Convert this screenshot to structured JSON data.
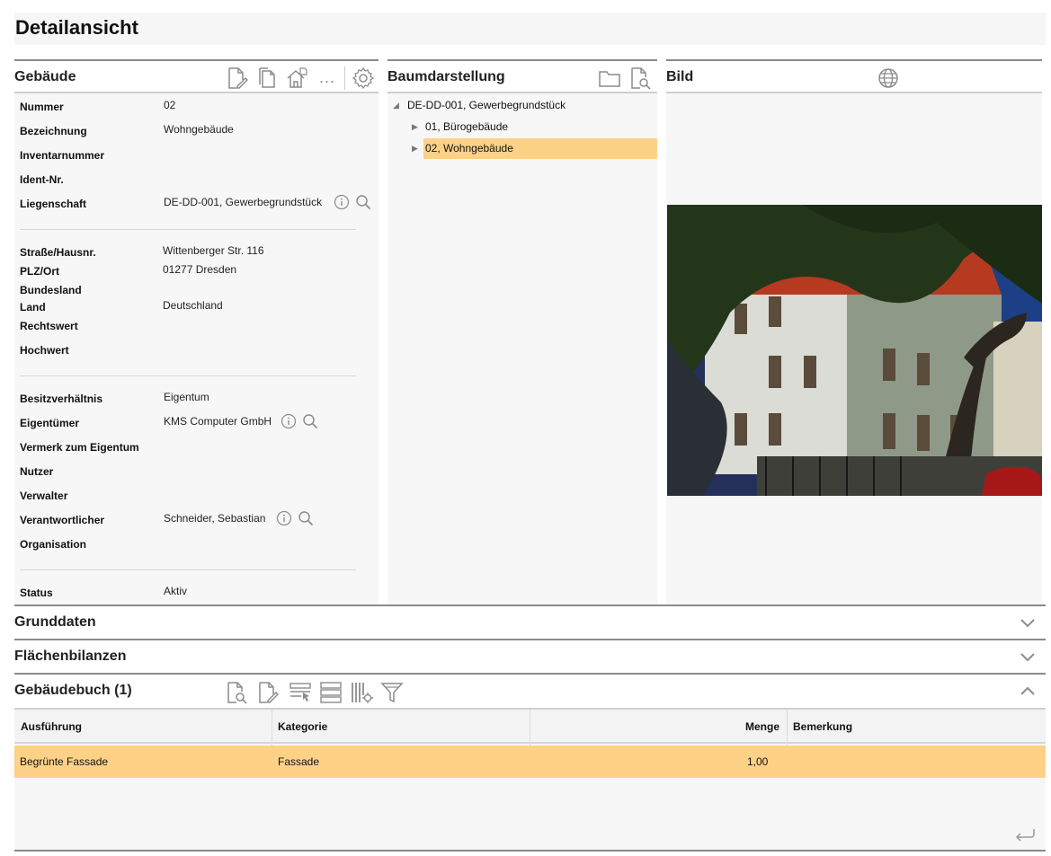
{
  "page": {
    "title": "Detailansicht"
  },
  "gebaeude": {
    "title": "Gebäude",
    "fields": {
      "nummer": {
        "label": "Nummer",
        "value": "02"
      },
      "bezeichnung": {
        "label": "Bezeichnung",
        "value": "Wohngebäude"
      },
      "inventarnummer": {
        "label": "Inventarnummer",
        "value": ""
      },
      "ident": {
        "label": "Ident-Nr.",
        "value": ""
      },
      "liegenschaft": {
        "label": "Liegenschaft",
        "value": "DE-DD-001, Gewerbegrundstück"
      },
      "strasse": {
        "label": "Straße/Hausnr.",
        "value": "Wittenberger Str. 116"
      },
      "plz": {
        "label": "PLZ/Ort",
        "value": "01277 Dresden"
      },
      "bundesland": {
        "label": "Bundesland",
        "value": ""
      },
      "land": {
        "label": "Land",
        "value": "Deutschland"
      },
      "rechtswert": {
        "label": "Rechtswert",
        "value": ""
      },
      "hochwert": {
        "label": "Hochwert",
        "value": ""
      },
      "besitz": {
        "label": "Besitzverhältnis",
        "value": "Eigentum"
      },
      "eigentuemer": {
        "label": "Eigentümer",
        "value": "KMS Computer GmbH"
      },
      "vermerk": {
        "label": "Vermerk zum Eigentum",
        "value": ""
      },
      "nutzer": {
        "label": "Nutzer",
        "value": ""
      },
      "verwalter": {
        "label": "Verwalter",
        "value": ""
      },
      "verantwortlicher": {
        "label": "Verantwortlicher",
        "value": "Schneider, Sebastian"
      },
      "organisation": {
        "label": "Organisation",
        "value": ""
      },
      "status": {
        "label": "Status",
        "value": "Aktiv"
      }
    },
    "more_label": "..."
  },
  "baum": {
    "title": "Baumdarstellung",
    "nodes": [
      {
        "label": "DE-DD-001, Gewerbegrundstück",
        "expanded": true
      },
      {
        "label": "01, Bürogebäude",
        "expanded": false
      },
      {
        "label": "02, Wohngebäude",
        "expanded": false,
        "selected": true
      }
    ]
  },
  "bild": {
    "title": "Bild"
  },
  "sections": {
    "grunddaten": {
      "title": "Grunddaten",
      "collapsed": true
    },
    "flaechen": {
      "title": "Flächenbilanzen",
      "collapsed": true
    },
    "gebaeudebuch": {
      "title": "Gebäudebuch (1)",
      "collapsed": false
    }
  },
  "table": {
    "columns": [
      "Ausführung",
      "Kategorie",
      "Menge",
      "Bemerkung"
    ],
    "rows": [
      {
        "ausfuehrung": "Begrünte Fassade",
        "kategorie": "Fassade",
        "menge": "1,00",
        "bemerkung": ""
      }
    ]
  },
  "colors": {
    "selection": "#fdd287",
    "panel_bg": "#f7f7f7",
    "icon": "#8c8c8c"
  }
}
